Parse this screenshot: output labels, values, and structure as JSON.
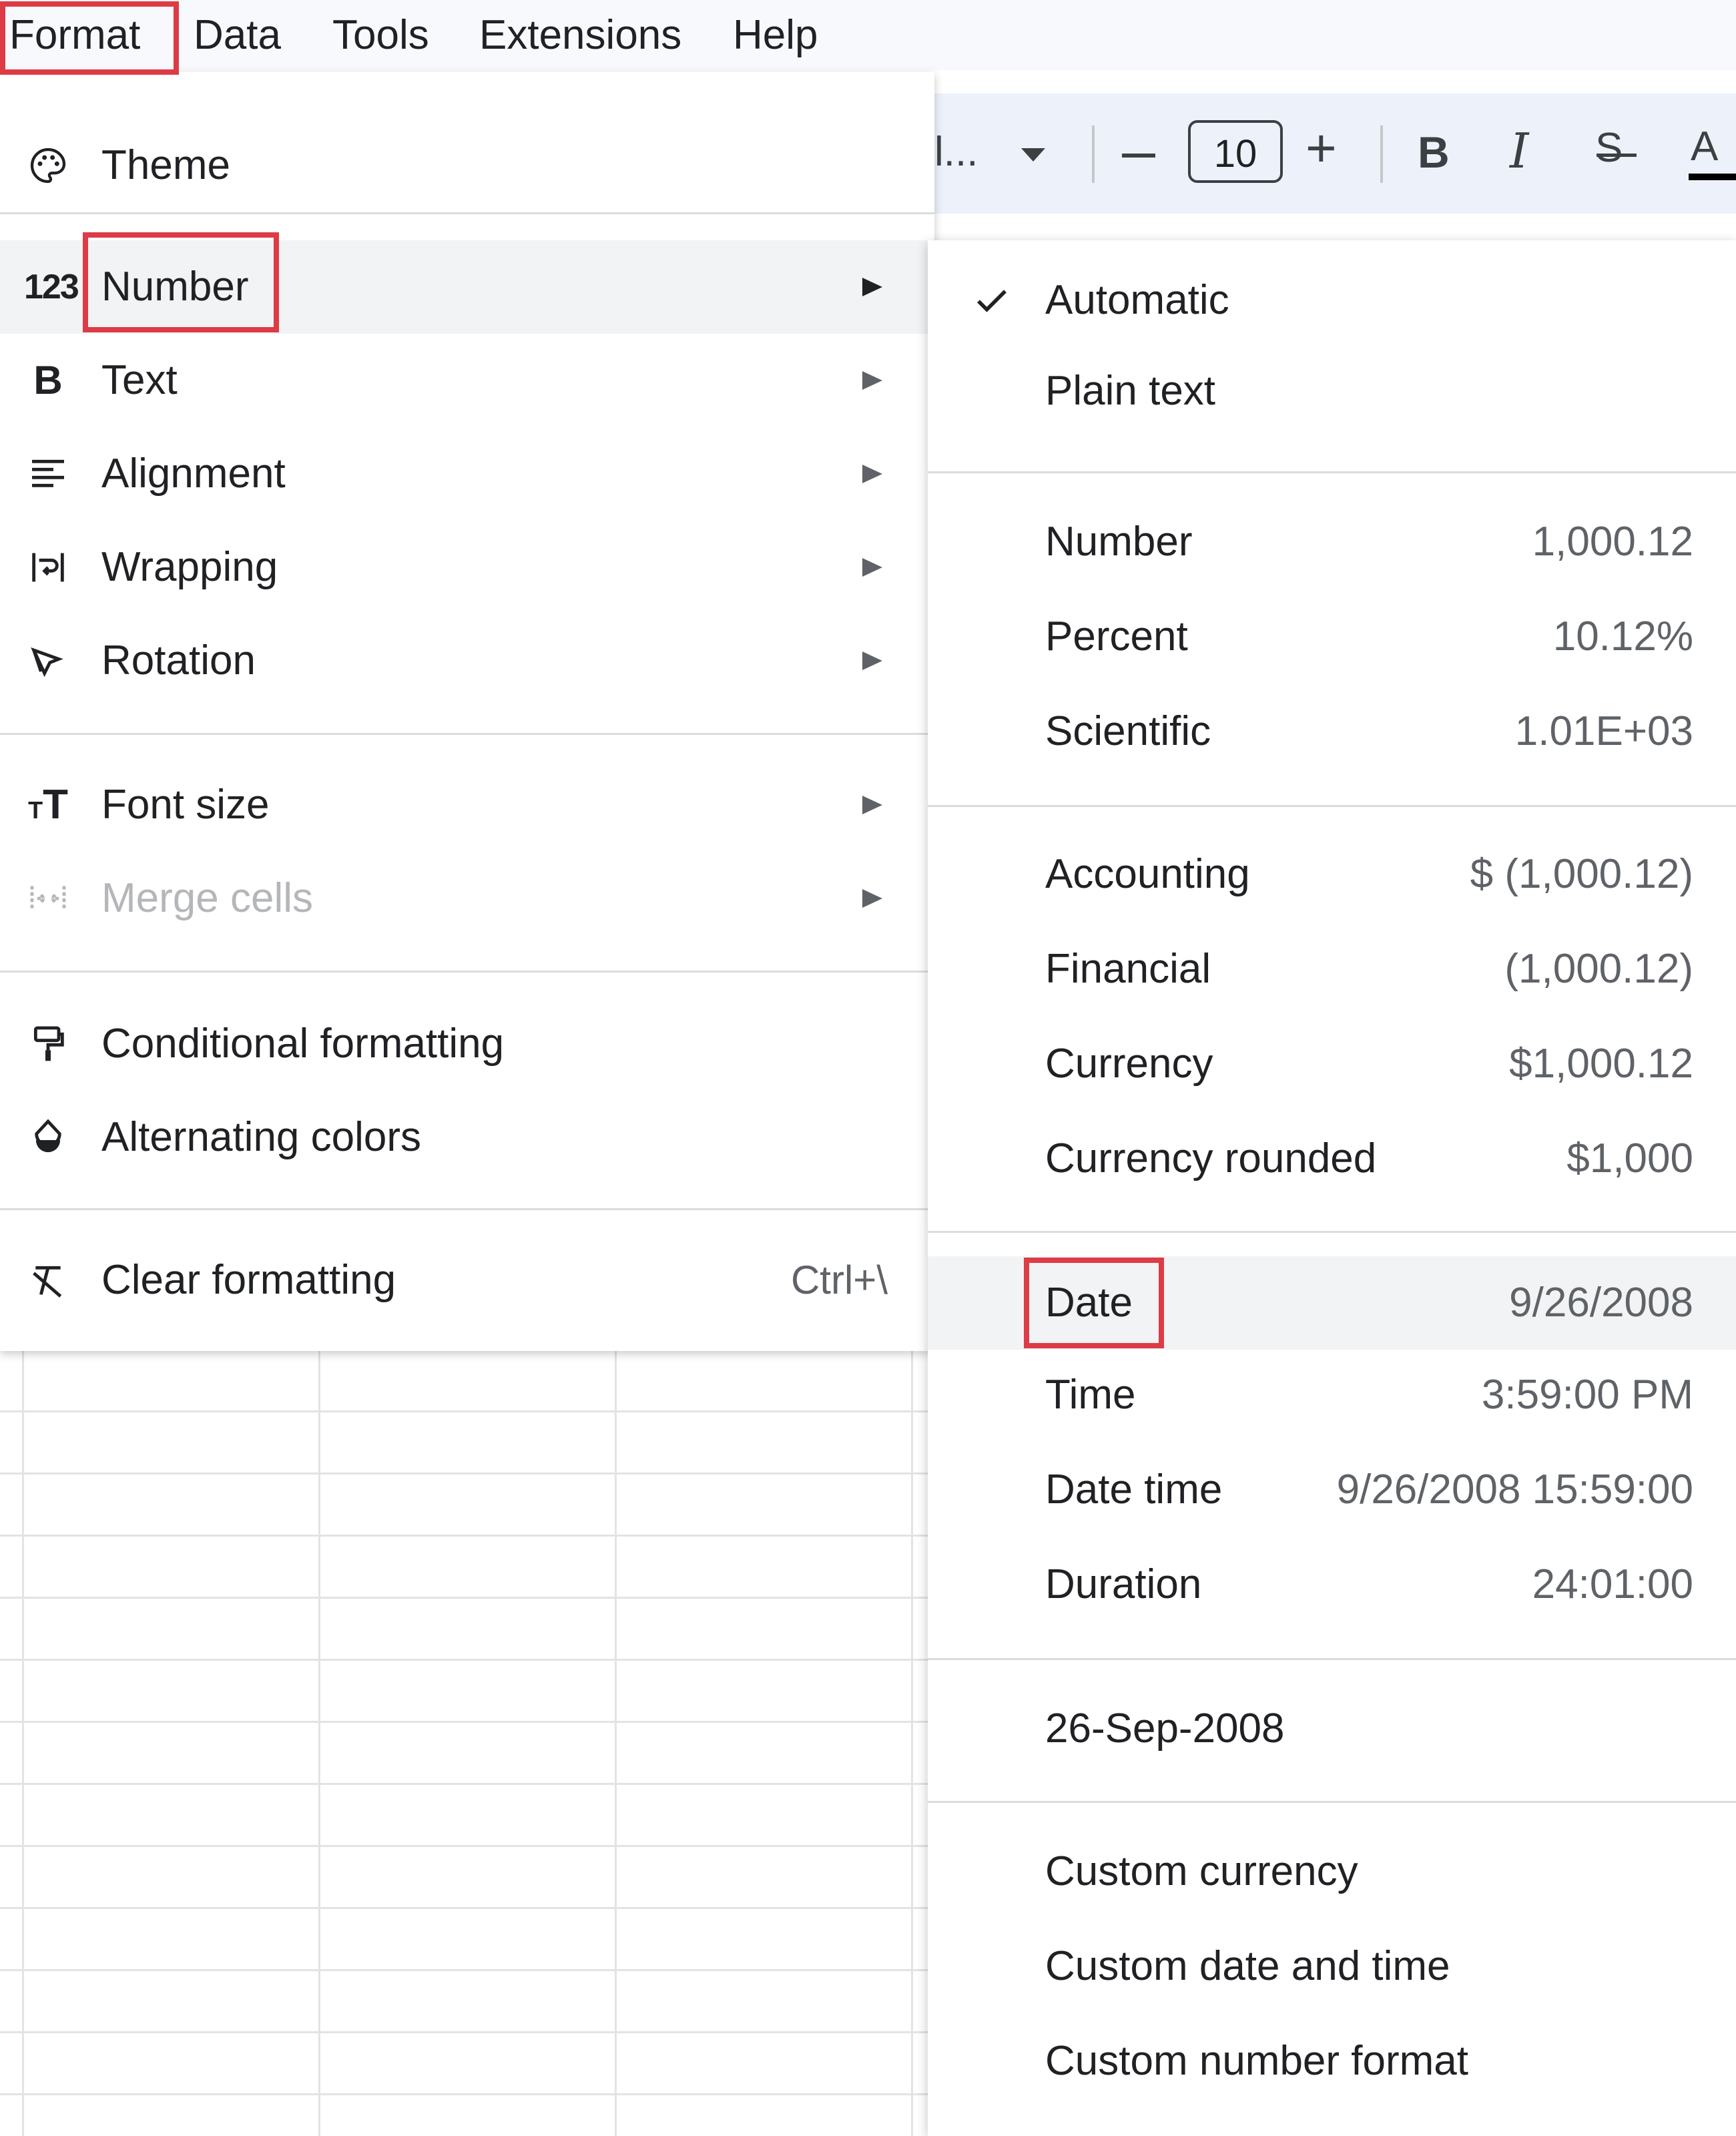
{
  "menubar": {
    "items": [
      {
        "label": "Format"
      },
      {
        "label": "Data"
      },
      {
        "label": "Tools"
      },
      {
        "label": "Extensions"
      },
      {
        "label": "Help"
      }
    ]
  },
  "toolbar": {
    "font_name": "l...",
    "font_size": "10",
    "decrease": "–",
    "increase": "+",
    "bold": "B",
    "italic": "I",
    "strike": "S",
    "text_color": "A"
  },
  "format_menu": {
    "items": [
      {
        "label": "Theme",
        "icon": "palette-icon"
      },
      {
        "label": "Number",
        "icon": "number-123-icon",
        "submenu": true
      },
      {
        "label": "Text",
        "icon": "bold-icon",
        "submenu": true
      },
      {
        "label": "Alignment",
        "icon": "align-left-icon",
        "submenu": true
      },
      {
        "label": "Wrapping",
        "icon": "wrap-text-icon",
        "submenu": true
      },
      {
        "label": "Rotation",
        "icon": "text-rotation-icon",
        "submenu": true
      },
      {
        "label": "Font size",
        "icon": "font-size-icon",
        "submenu": true
      },
      {
        "label": "Merge cells",
        "icon": "merge-cells-icon",
        "submenu": true,
        "disabled": true
      },
      {
        "label": "Conditional formatting",
        "icon": "paint-roller-icon"
      },
      {
        "label": "Alternating colors",
        "icon": "color-drop-icon"
      },
      {
        "label": "Clear formatting",
        "icon": "clear-format-icon",
        "shortcut": "Ctrl+\\"
      }
    ]
  },
  "number_submenu": {
    "items": [
      {
        "label": "Automatic",
        "checked": true
      },
      {
        "label": "Plain text"
      },
      {
        "label": "Number",
        "example": "1,000.12"
      },
      {
        "label": "Percent",
        "example": "10.12%"
      },
      {
        "label": "Scientific",
        "example": "1.01E+03"
      },
      {
        "label": "Accounting",
        "example": "$ (1,000.12)"
      },
      {
        "label": "Financial",
        "example": "(1,000.12)"
      },
      {
        "label": "Currency",
        "example": "$1,000.12"
      },
      {
        "label": "Currency rounded",
        "example": "$1,000"
      },
      {
        "label": "Date",
        "example": "9/26/2008"
      },
      {
        "label": "Time",
        "example": "3:59:00 PM"
      },
      {
        "label": "Date time",
        "example": "9/26/2008 15:59:00"
      },
      {
        "label": "Duration",
        "example": "24:01:00"
      },
      {
        "label": "26-Sep-2008"
      },
      {
        "label": "Custom currency"
      },
      {
        "label": "Custom date and time"
      },
      {
        "label": "Custom number format"
      }
    ]
  },
  "colors": {
    "highlight": "#dd3b45",
    "menubar_bg": "#f8f9fc",
    "toolbar_bg": "#edf2fa",
    "hover_bg": "#f1f3f4"
  }
}
